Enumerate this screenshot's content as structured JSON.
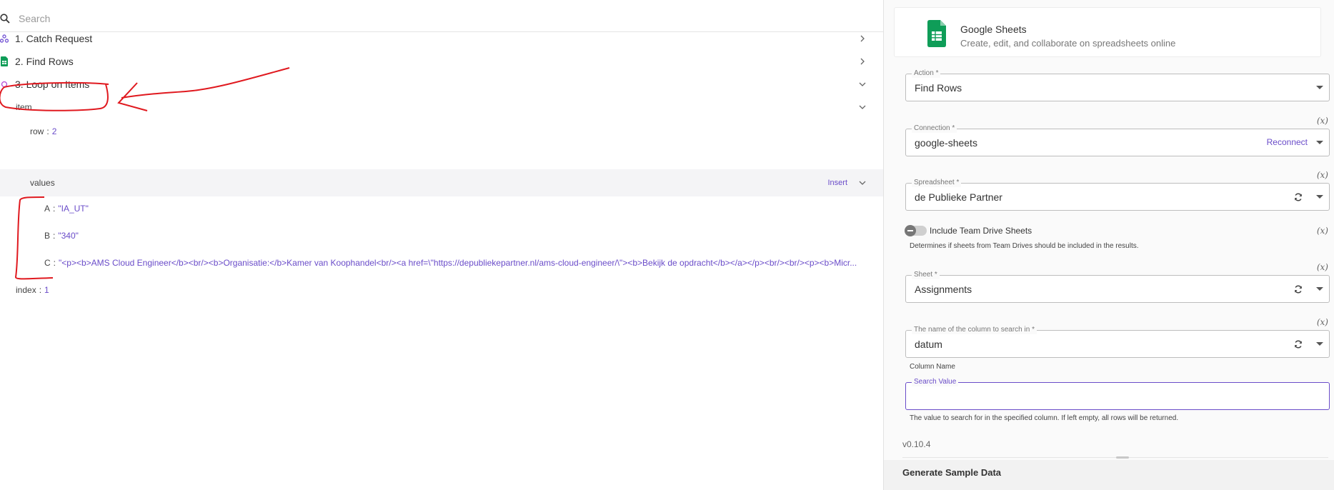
{
  "search": {
    "placeholder": "Search"
  },
  "steps": [
    {
      "label": "1. Catch Request",
      "icon": "webhook-icon"
    },
    {
      "label": "2. Find Rows",
      "icon": "google-sheets-icon"
    },
    {
      "label": "3. Loop on Items",
      "icon": "loop-icon"
    }
  ],
  "tree": {
    "item_key": "item",
    "row_key": "row",
    "row_val": "2",
    "values_key": "values",
    "insert_label": "Insert",
    "a_key": "A",
    "a_val": "\"IA_UT\"",
    "b_key": "B",
    "b_val": "\"340\"",
    "c_key": "C",
    "c_val": "\"<p><b>AMS Cloud Engineer</b><br/><b>Organisatie:</b>Kamer van Koophandel<br/><a href=\\\"https://depubliekepartner.nl/ams-cloud-engineer/\\\"><b>Bekijk de opdracht</b></a></p><br/><br/><p><b>Micr...",
    "index_key": "index",
    "index_val": "1",
    "separator": ":"
  },
  "piece": {
    "title": "Google Sheets",
    "subtitle": "Create, edit, and collaborate on spreadsheets online"
  },
  "form": {
    "action_label": "Action *",
    "action_value": "Find Rows",
    "fx": "(x)",
    "connection_label": "Connection *",
    "connection_value": "google-sheets",
    "reconnect": "Reconnect",
    "spreadsheet_label": "Spreadsheet *",
    "spreadsheet_value": "de Publieke Partner",
    "team_drive_label": "Include Team Drive Sheets",
    "team_drive_desc": "Determines if sheets from Team Drives should be included in the results.",
    "sheet_label": "Sheet *",
    "sheet_value": "Assignments",
    "column_label": "The name of the column to search in *",
    "column_value": "datum",
    "column_help": "Column Name",
    "search_value_label": "Search Value",
    "search_value_help": "The value to search for in the specified column. If left empty, all rows will be returned."
  },
  "footer": {
    "version": "v0.10.4",
    "generate": "Generate Sample Data"
  },
  "colors": {
    "accent": "#6a4cc9",
    "sheets_green": "#0f9d58",
    "annotation_red": "#e0191f"
  }
}
